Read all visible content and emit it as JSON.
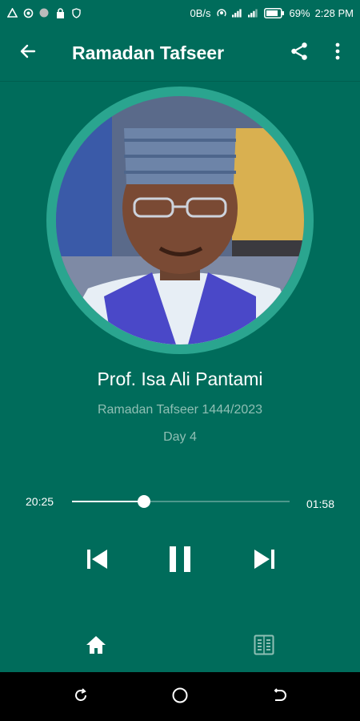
{
  "status_bar": {
    "net_speed": "0B/s",
    "battery": "69%",
    "time": "2:28 PM"
  },
  "app_bar": {
    "title": "Ramadan Tafseer"
  },
  "player": {
    "speaker": "Prof. Isa Ali Pantami",
    "album": "Ramadan Tafseer 1444/2023",
    "episode": "Day 4",
    "time_elapsed": "20:25",
    "time_remaining": "01:58",
    "progress_fraction": 0.33,
    "is_playing": true
  },
  "colors": {
    "primary": "#006c5b",
    "accent_ring": "#2aa58f",
    "muted_text": "#8fbfb4",
    "system_nav": "#000000"
  },
  "bottom_nav": {
    "items": [
      {
        "icon": "home-icon",
        "active": true
      },
      {
        "icon": "list-icon",
        "active": false
      }
    ]
  }
}
